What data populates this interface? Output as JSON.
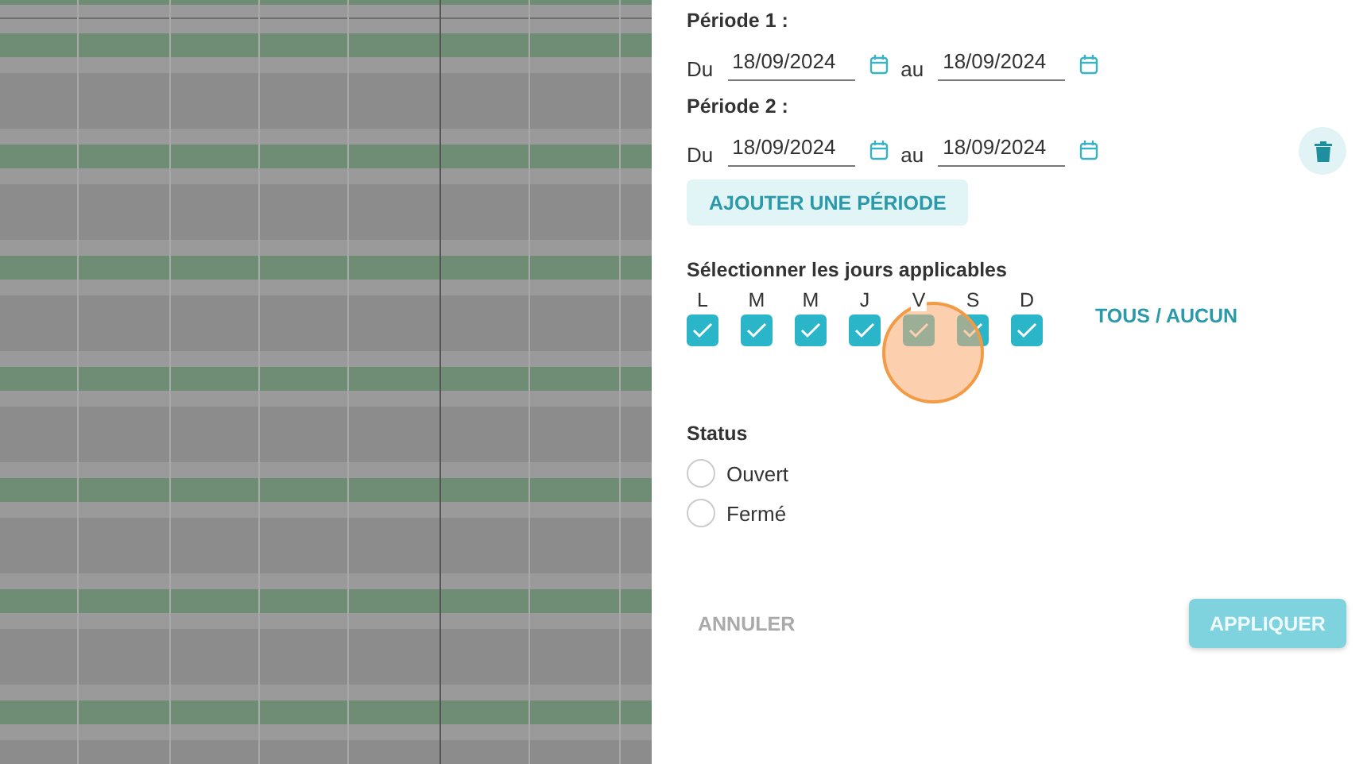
{
  "periods": [
    {
      "title": "Période 1 :",
      "from_label": "Du",
      "from": "18/09/2024",
      "to_label": "au",
      "to": "18/09/2024",
      "deletable": false
    },
    {
      "title": "Période 2 :",
      "from_label": "Du",
      "from": "18/09/2024",
      "to_label": "au",
      "to": "18/09/2024",
      "deletable": true
    }
  ],
  "add_button": "AJOUTER UNE PÉRIODE",
  "days": {
    "title": "Sélectionner les jours applicables",
    "toggle_all": "TOUS / AUCUN",
    "items": [
      {
        "label": "L",
        "checked": true
      },
      {
        "label": "M",
        "checked": true
      },
      {
        "label": "M",
        "checked": true
      },
      {
        "label": "J",
        "checked": true
      },
      {
        "label": "V",
        "checked": true
      },
      {
        "label": "S",
        "checked": true
      },
      {
        "label": "D",
        "checked": true
      }
    ]
  },
  "status": {
    "title": "Status",
    "options": [
      {
        "label": "Ouvert",
        "selected": false
      },
      {
        "label": "Fermé",
        "selected": false
      }
    ]
  },
  "footer": {
    "cancel": "ANNULER",
    "apply": "APPLIQUER",
    "apply_disabled": true
  }
}
